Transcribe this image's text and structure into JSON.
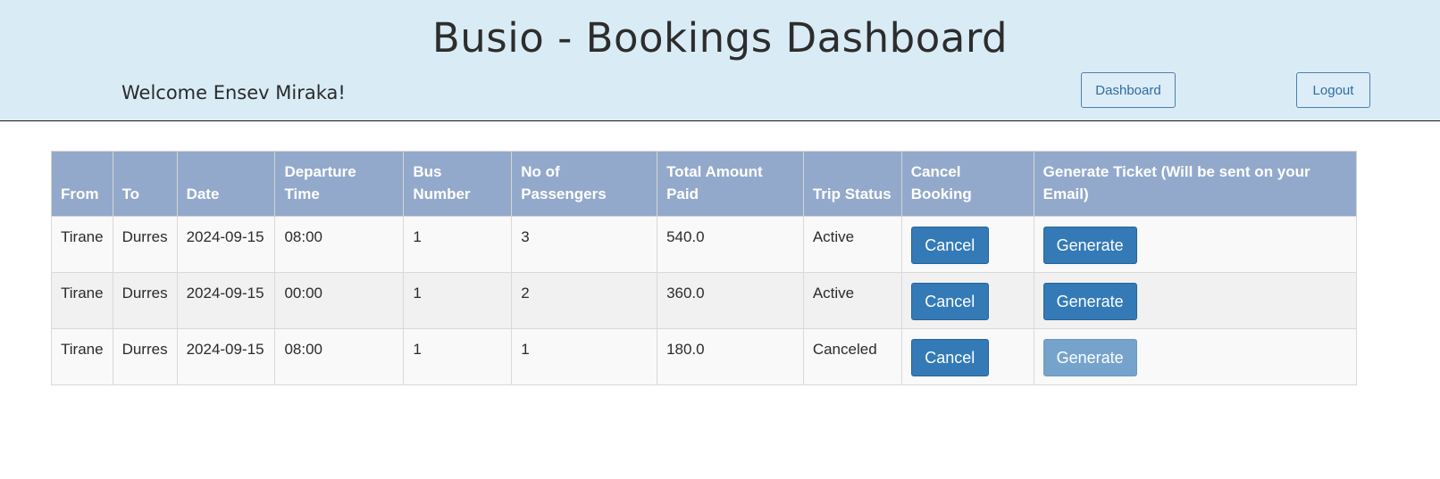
{
  "header": {
    "title": "Busio - Bookings Dashboard",
    "welcome": "Welcome Ensev Miraka!",
    "dashboard_label": "Dashboard",
    "logout_label": "Logout"
  },
  "table": {
    "columns": [
      "From",
      "To",
      "Date",
      "Departure Time",
      "Bus Number",
      "No of Passengers",
      "Total Amount Paid",
      "Trip Status",
      "Cancel Booking",
      "Generate Ticket (Will be sent on your Email)"
    ],
    "rows": [
      {
        "from": "Tirane",
        "to": "Durres",
        "date": "2024-09-15",
        "departure_time": "08:00",
        "bus_number": "1",
        "passengers": "3",
        "total_paid": "540.0",
        "status": "Active",
        "cancel_label": "Cancel",
        "generate_label": "Generate",
        "generate_disabled": false
      },
      {
        "from": "Tirane",
        "to": "Durres",
        "date": "2024-09-15",
        "departure_time": "00:00",
        "bus_number": "1",
        "passengers": "2",
        "total_paid": "360.0",
        "status": "Active",
        "cancel_label": "Cancel",
        "generate_label": "Generate",
        "generate_disabled": false
      },
      {
        "from": "Tirane",
        "to": "Durres",
        "date": "2024-09-15",
        "departure_time": "08:00",
        "bus_number": "1",
        "passengers": "1",
        "total_paid": "180.0",
        "status": "Canceled",
        "cancel_label": "Cancel",
        "generate_label": "Generate",
        "generate_disabled": true
      }
    ]
  },
  "colors": {
    "header_bg": "#d9ecf6",
    "table_header_bg": "#93a9cb",
    "button_primary": "#337ab7",
    "button_disabled": "#76a3cc"
  }
}
